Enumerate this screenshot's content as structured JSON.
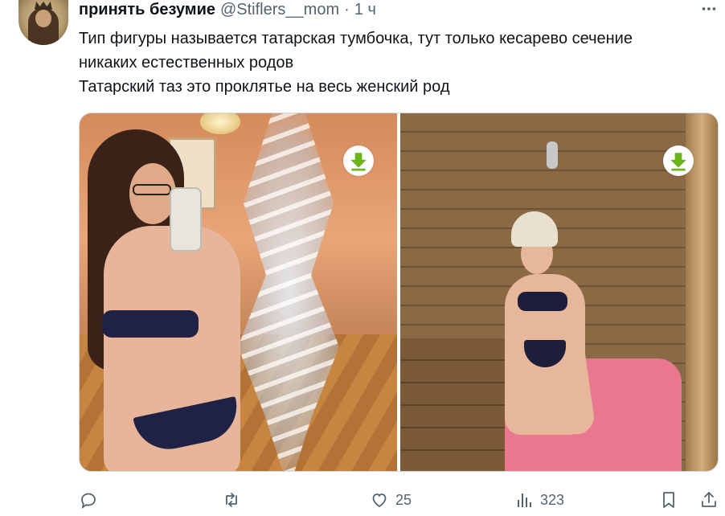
{
  "tweet": {
    "author": {
      "display_name": "принять безумие",
      "handle": "@Stiflers__mom",
      "separator": "·",
      "time": "1 ч"
    },
    "text_lines": [
      "Тип фигуры называется татарская тумбочка, тут только кесарево сечение",
      "никаких естественных родов",
      "Татарский таз это проклятье на весь женский род"
    ],
    "media": [
      {
        "icon": "download-arrow-icon"
      },
      {
        "icon": "download-arrow-icon"
      }
    ],
    "actions": {
      "reply": {
        "icon": "reply-icon",
        "count": ""
      },
      "retweet": {
        "icon": "retweet-icon",
        "count": ""
      },
      "like": {
        "icon": "heart-icon",
        "count": "25"
      },
      "views": {
        "icon": "views-chart-icon",
        "count": "323"
      },
      "bookmark": {
        "icon": "bookmark-icon"
      },
      "share": {
        "icon": "share-icon"
      }
    }
  },
  "colors": {
    "text_primary": "#0f1419",
    "text_secondary": "#536471",
    "download_badge_green": "#6ab417",
    "media_border": "#cfd9de"
  }
}
